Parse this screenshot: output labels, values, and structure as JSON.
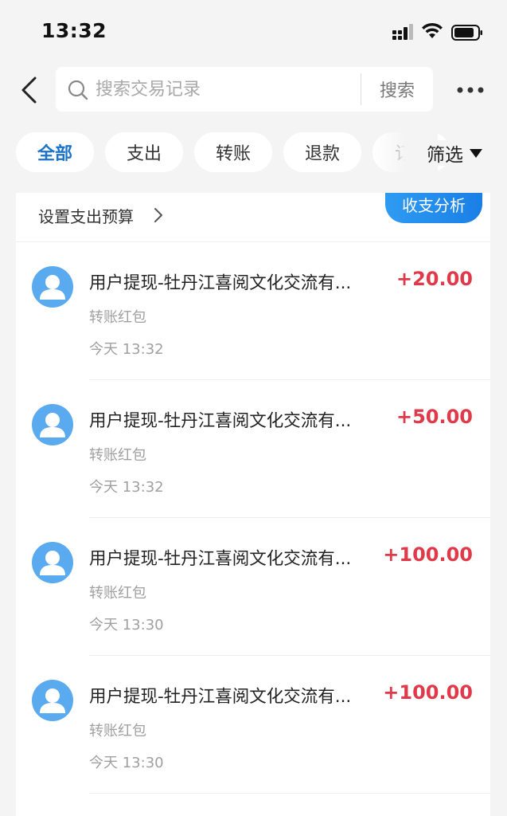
{
  "status_bar": {
    "time": "13:32",
    "icons": [
      "signal-icon",
      "wifi-icon",
      "battery-icon"
    ]
  },
  "header": {
    "back_icon": "chevron-left-icon",
    "search": {
      "placeholder": "搜索交易记录",
      "value": "",
      "button_label": "搜索"
    },
    "more_icon": "more-dots-icon"
  },
  "tabs": [
    {
      "label": "全部",
      "active": true
    },
    {
      "label": "支出",
      "active": false
    },
    {
      "label": "转账",
      "active": false
    },
    {
      "label": "退款",
      "active": false
    },
    {
      "label": "订单",
      "active": false
    }
  ],
  "filter": {
    "label": "筛选"
  },
  "budget": {
    "label": "设置支出预算",
    "analysis_button": "收支分析"
  },
  "transactions": [
    {
      "title": "用户提现-牡丹江喜阅文化交流有...",
      "amount": "+20.00",
      "category": "转账红包",
      "time": "今天 13:32"
    },
    {
      "title": "用户提现-牡丹江喜阅文化交流有...",
      "amount": "+50.00",
      "category": "转账红包",
      "time": "今天 13:32"
    },
    {
      "title": "用户提现-牡丹江喜阅文化交流有...",
      "amount": "+100.00",
      "category": "转账红包",
      "time": "今天 13:30"
    },
    {
      "title": "用户提现-牡丹江喜阅文化交流有...",
      "amount": "+100.00",
      "category": "转账红包",
      "time": "今天 13:30"
    }
  ],
  "colors": {
    "accent": "#1a73c9",
    "amount_income": "#e0394a",
    "avatar": "#5aaaf0",
    "analysis_button": "#1a7fe6"
  }
}
